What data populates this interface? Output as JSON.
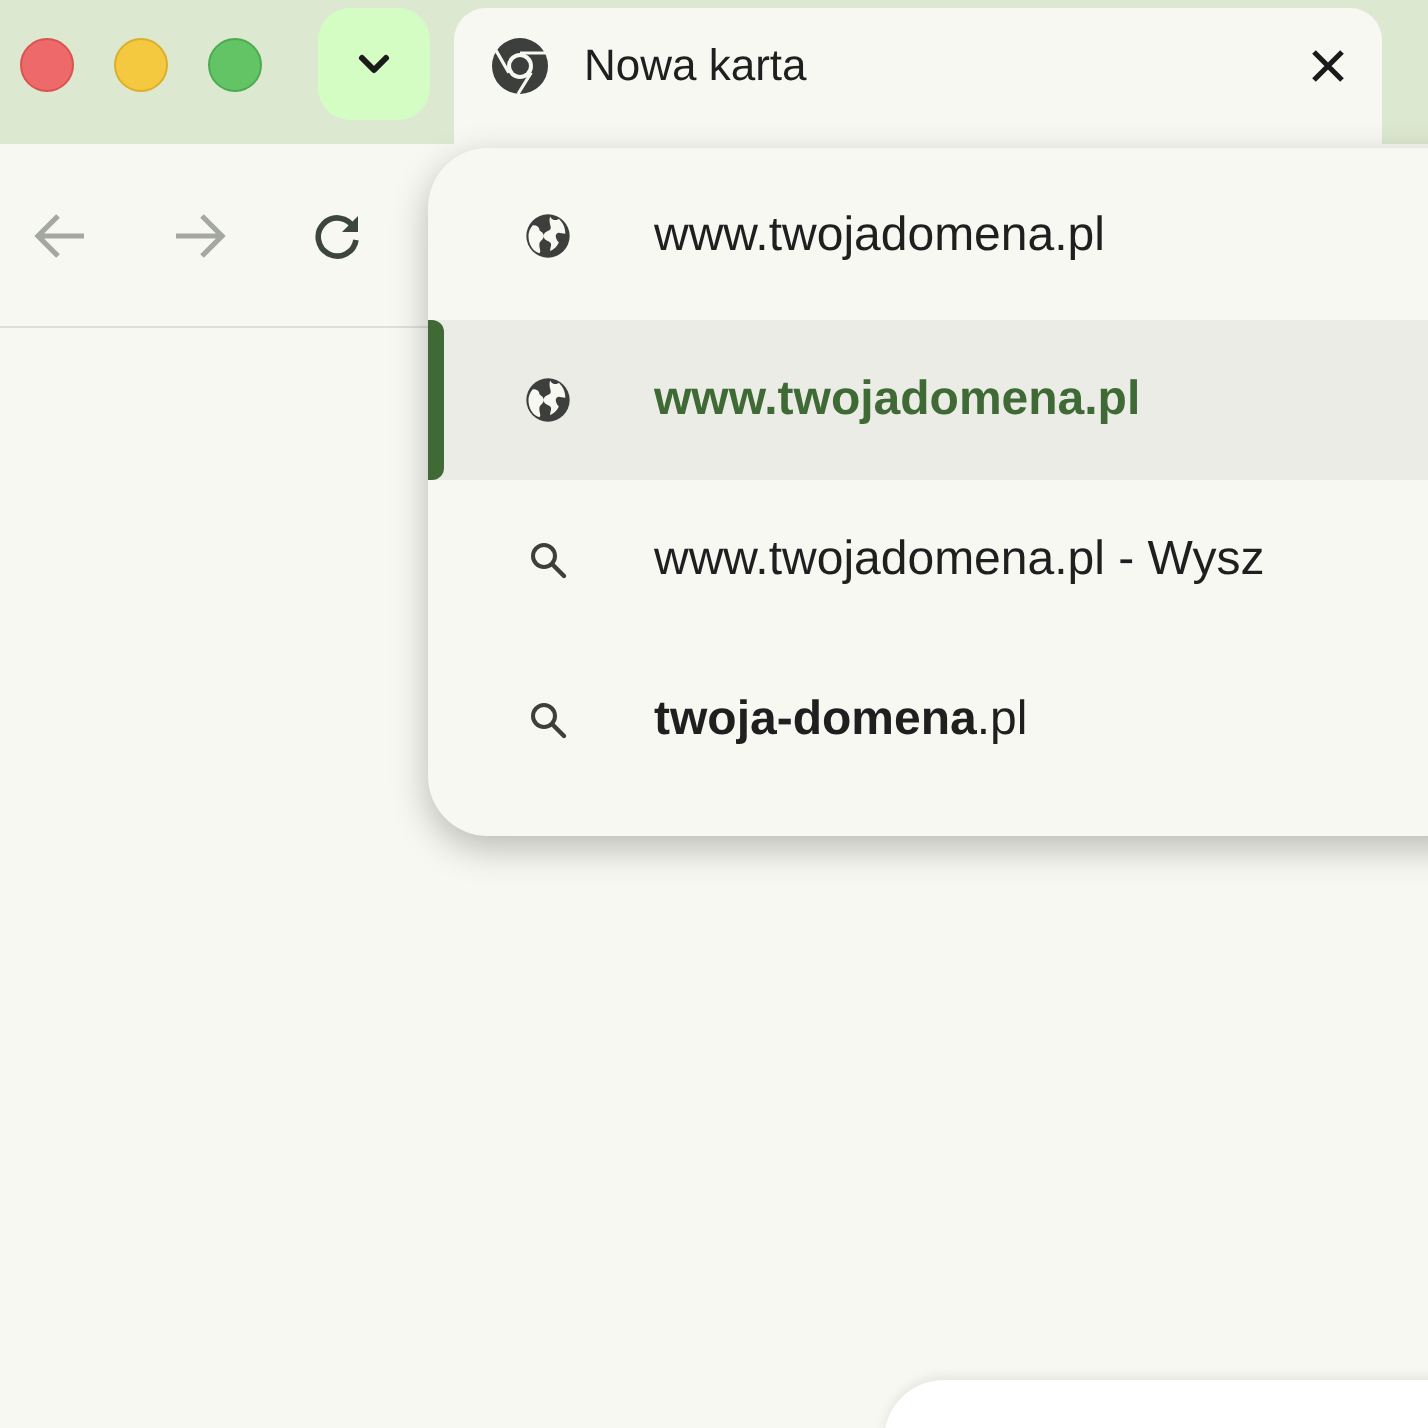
{
  "tab": {
    "title": "Nowa karta"
  },
  "suggestions": [
    {
      "kind": "globe",
      "text": "www.twojadomena.pl",
      "selected": false
    },
    {
      "kind": "globe",
      "text": "www.twojadomena.pl",
      "selected": true
    },
    {
      "kind": "search",
      "text": "www.twojadomena.pl - Wysz",
      "selected": false
    },
    {
      "kind": "search",
      "text": "**twoja-domena**.pl",
      "selected": false
    }
  ]
}
